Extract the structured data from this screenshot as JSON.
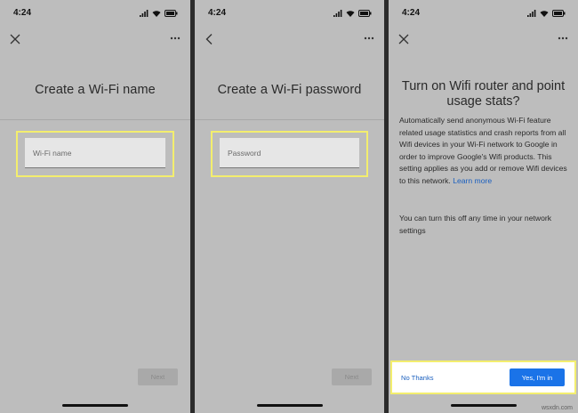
{
  "screens": [
    {
      "time": "4:24",
      "nav_icon": "close-icon",
      "title": "Create a Wi-Fi name",
      "field_placeholder": "Wi-Fi name",
      "next_label": "Next"
    },
    {
      "time": "4:24",
      "nav_icon": "back-arrow-icon",
      "title": "Create a Wi-Fi password",
      "field_placeholder": "Password",
      "next_label": "Next"
    },
    {
      "time": "4:24",
      "nav_icon": "close-icon",
      "title": "Turn on Wifi router and point usage stats?",
      "body_text": "Automatically send anonymous Wi-Fi feature related usage statistics and crash reports from all Wifi devices in your Wi-Fi network to Google in order to improve Google's Wifi products. This setting applies as you add or remove Wifi devices to this network.",
      "learn_more": "Learn more",
      "secondary_text": "You can turn this off any time in your network settings",
      "no_thanks_label": "No Thanks",
      "yes_label": "Yes, I'm in"
    }
  ],
  "watermark": "wsxdn.com",
  "colors": {
    "highlight": "#f3ee6e",
    "primary_blue": "#1a73e8",
    "screen_bg": "#bdbdbd"
  }
}
